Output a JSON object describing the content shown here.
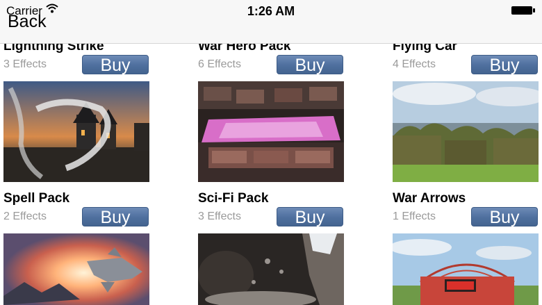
{
  "status": {
    "carrier": "Carrier",
    "time": "1:26 AM"
  },
  "nav": {
    "back_label": "Back"
  },
  "items": [
    {
      "title": "Lightning Strike",
      "effects": "3 Effects",
      "buy_label": "Buy"
    },
    {
      "title": "War Hero Pack",
      "effects": "6 Effects",
      "buy_label": "Buy"
    },
    {
      "title": "Flying Car",
      "effects": "4 Effects",
      "buy_label": "Buy"
    },
    {
      "title": "Spell Pack",
      "effects": "2 Effects",
      "buy_label": "Buy"
    },
    {
      "title": "Sci-Fi Pack",
      "effects": "3 Effects",
      "buy_label": "Buy"
    },
    {
      "title": "War Arrows",
      "effects": "1 Effects",
      "buy_label": "Buy"
    }
  ],
  "colors": {
    "buy_button": "#4e6f9e",
    "effects_text": "#9a9a9a"
  }
}
